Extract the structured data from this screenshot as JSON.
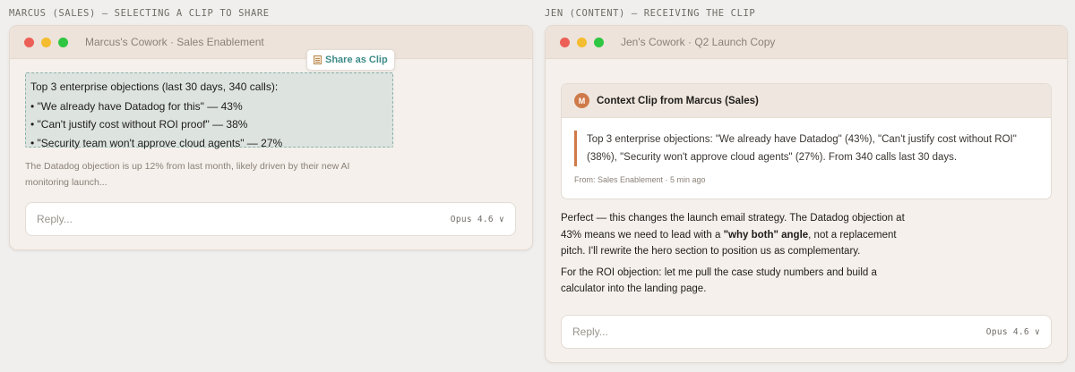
{
  "captions": {
    "left": "MARCUS (SALES) — SELECTING A CLIP TO SHARE",
    "right": "JEN (CONTENT) — RECEIVING THE CLIP"
  },
  "marcus_window": {
    "title": "Marcus's Cowork · Sales Enablement",
    "selection_lines": [
      "Top 3 enterprise objections (last 30 days, 340 calls):",
      "• \"We already have Datadog for this\" — 43%",
      "• \"Can't justify cost without ROI proof\" — 38%",
      "• \"Security team won't approve cloud agents\" — 27%"
    ],
    "share_button": "Share as Clip",
    "share_icon": "clipboard-icon",
    "followup_text": "The Datadog objection is up 12% from last month, likely driven by their new AI monitoring launch...",
    "reply_placeholder": "Reply...",
    "model_label": "Opus 4.6 ∨"
  },
  "jen_window": {
    "title": "Jen's Cowork · Q2 Launch Copy",
    "clip": {
      "badge": "M",
      "title": "Context Clip from Marcus (Sales)",
      "quote": "Top 3 enterprise objections: \"We already have Datadog\" (43%), \"Can't justify cost without ROI\" (38%), \"Security won't approve cloud agents\" (27%). From 340 calls last 30 days.",
      "meta": "From: Sales Enablement · 5 min ago"
    },
    "response_p1_before": "Perfect — this changes the launch email strategy. The Datadog objection at 43% means we need to lead with a ",
    "response_p1_bold": "\"why both\" angle",
    "response_p1_after": ", not a replacement pitch. I'll rewrite the hero section to position us as complementary.",
    "response_p2": "For the ROI objection: let me pull the case study numbers and build a calculator into the landing page.",
    "reply_placeholder": "Reply...",
    "model_label": "Opus 4.6 ∨"
  },
  "colors": {
    "accent_teal": "#3d8b87",
    "accent_orange": "#cf7a4a",
    "window_bg": "#f5f0eb",
    "titlebar_bg": "#ede3da"
  }
}
